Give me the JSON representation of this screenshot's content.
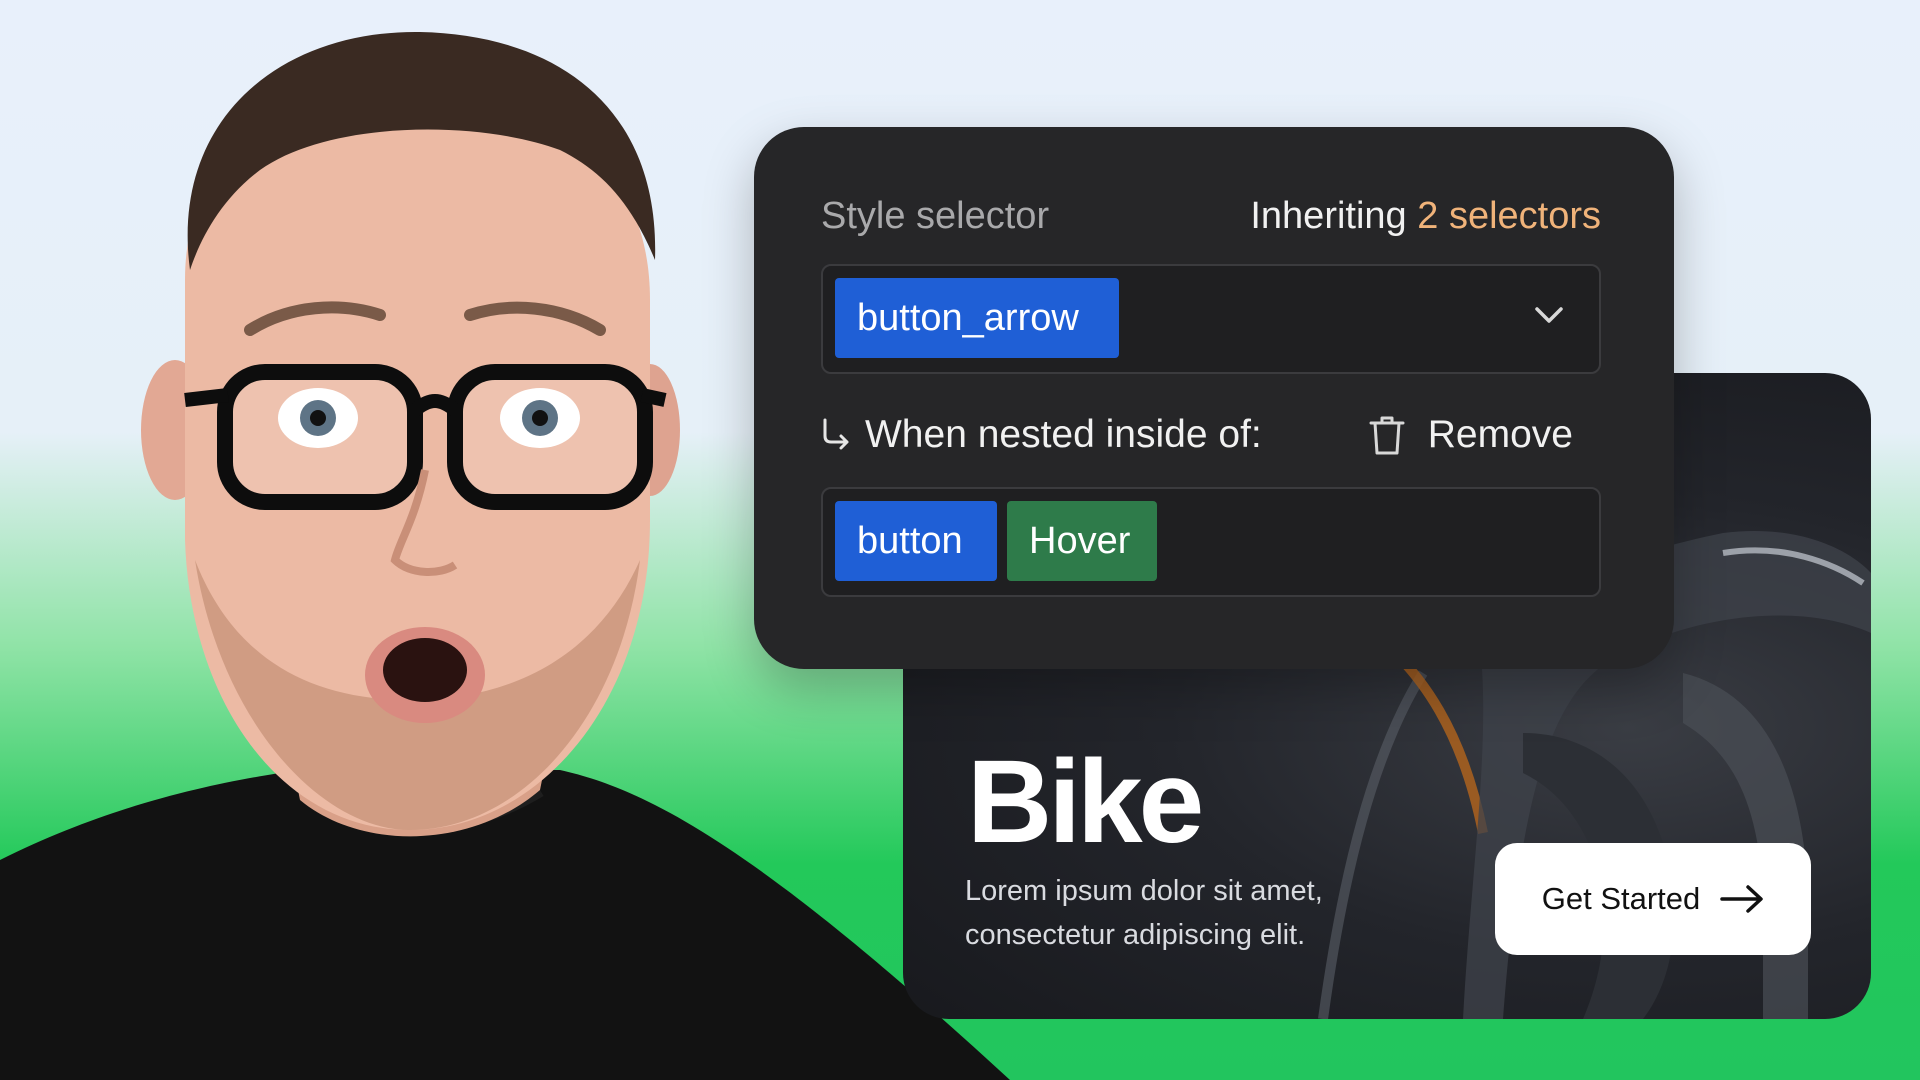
{
  "panel": {
    "label": "Style selector",
    "inheriting_prefix": "Inheriting",
    "inheriting_count": "2 selectors",
    "selector_chip": "button_arrow",
    "nested_label": "When nested inside of:",
    "remove_label": "Remove",
    "parent_chip": "button",
    "state_chip": "Hover"
  },
  "card": {
    "title": "Bike",
    "desc_line1": "Lorem ipsum dolor sit amet,",
    "desc_line2": "consectetur adipiscing elit.",
    "cta_label": "Get Started"
  },
  "colors": {
    "panel_bg": "#262628",
    "selector_blue": "#1f5fd6",
    "state_green": "#2e7b4a",
    "accent_orange": "#f0b37a",
    "background_green": "#22c55e"
  },
  "icons": [
    "chevron-down-icon",
    "nested-arrow-icon",
    "trash-icon",
    "arrow-right-icon"
  ]
}
